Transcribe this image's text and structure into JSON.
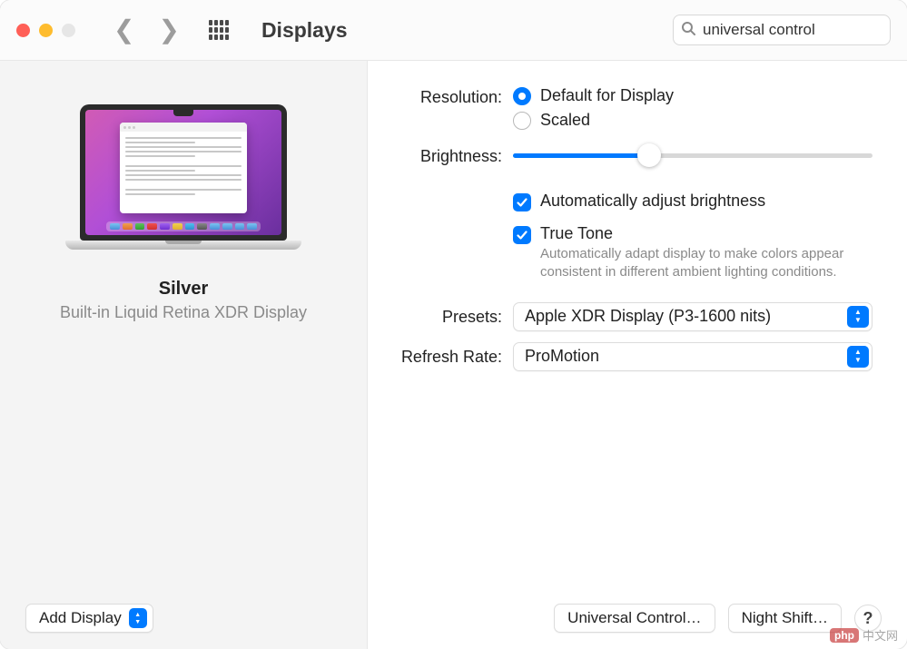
{
  "toolbar": {
    "title": "Displays",
    "search_value": "universal control"
  },
  "left": {
    "display_name": "Silver",
    "display_subtitle": "Built-in Liquid Retina XDR Display",
    "add_display_label": "Add Display"
  },
  "settings": {
    "resolution": {
      "label": "Resolution:",
      "opt_default": "Default for Display",
      "opt_scaled": "Scaled",
      "selected": "default"
    },
    "brightness": {
      "label": "Brightness:",
      "value_pct": 38
    },
    "auto_brightness": {
      "label": "Automatically adjust brightness",
      "checked": true
    },
    "true_tone": {
      "label": "True Tone",
      "desc": "Automatically adapt display to make colors appear consistent in different ambient lighting conditions.",
      "checked": true
    },
    "presets": {
      "label": "Presets:",
      "value": "Apple XDR Display (P3-1600 nits)"
    },
    "refresh_rate": {
      "label": "Refresh Rate:",
      "value": "ProMotion"
    }
  },
  "footer": {
    "universal_control": "Universal Control…",
    "night_shift": "Night Shift…",
    "help": "?"
  },
  "watermark": {
    "logo": "php",
    "text": "中文网"
  }
}
